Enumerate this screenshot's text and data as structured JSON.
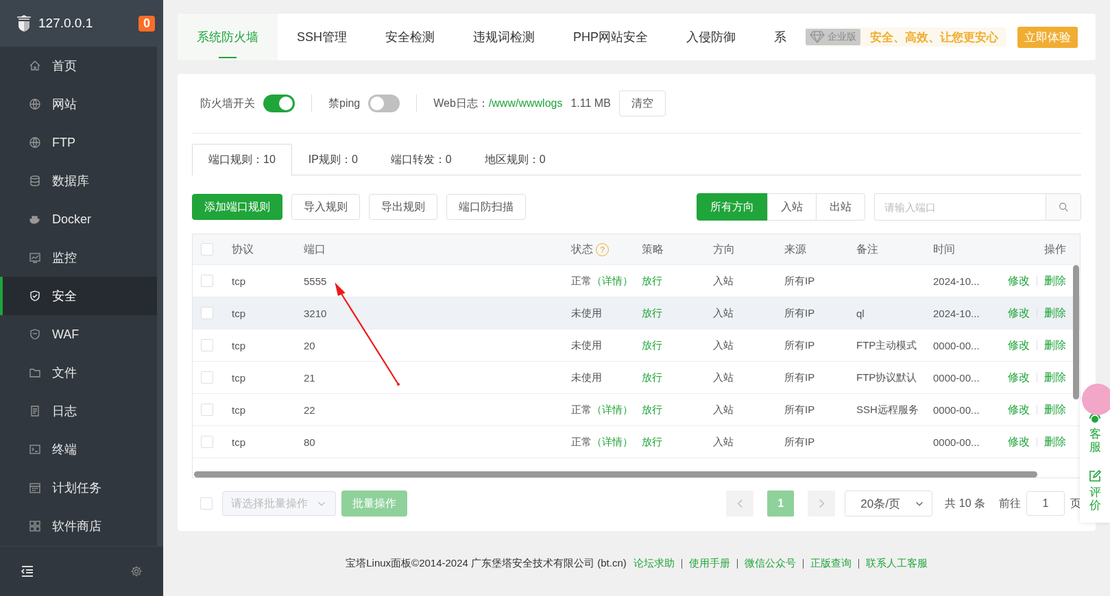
{
  "sidebar": {
    "host": "127.0.0.1",
    "badge": "0",
    "items": [
      {
        "label": "首页",
        "selected": false
      },
      {
        "label": "网站",
        "selected": false
      },
      {
        "label": "FTP",
        "selected": false
      },
      {
        "label": "数据库",
        "selected": false
      },
      {
        "label": "Docker",
        "selected": false
      },
      {
        "label": "监控",
        "selected": false
      },
      {
        "label": "安全",
        "selected": true
      },
      {
        "label": "WAF",
        "selected": false
      },
      {
        "label": "文件",
        "selected": false
      },
      {
        "label": "日志",
        "selected": false
      },
      {
        "label": "终端",
        "selected": false
      },
      {
        "label": "计划任务",
        "selected": false
      },
      {
        "label": "软件商店",
        "selected": false
      }
    ]
  },
  "top_tabs": [
    {
      "label": "系统防火墙",
      "selected": true
    },
    {
      "label": "SSH管理",
      "selected": false
    },
    {
      "label": "安全检测",
      "selected": false
    },
    {
      "label": "违规词检测",
      "selected": false
    },
    {
      "label": "PHP网站安全",
      "selected": false
    },
    {
      "label": "入侵防御",
      "selected": false
    },
    {
      "label": "系",
      "selected": false
    }
  ],
  "promo": {
    "badge": "企业版",
    "slogan": "安全、高效、让您更安心",
    "button": "立即体验"
  },
  "firewall": {
    "switch_label": "防火墙开关",
    "switch_on": true,
    "ping_label": "禁ping",
    "ping_on": false,
    "log_label": "Web日志：",
    "log_path": "/www/wwwlogs",
    "log_size": "1.11 MB",
    "clear_button": "清空"
  },
  "rule_tabs": [
    {
      "label": "端口规则：10",
      "selected": true
    },
    {
      "label": "IP规则：0",
      "selected": false
    },
    {
      "label": "端口转发：0",
      "selected": false
    },
    {
      "label": "地区规则：0",
      "selected": false
    }
  ],
  "actions": [
    {
      "label": "添加端口规则",
      "kind": "primary"
    },
    {
      "label": "导入规则",
      "kind": "default"
    },
    {
      "label": "导出规则",
      "kind": "default"
    },
    {
      "label": "端口防扫描",
      "kind": "default"
    }
  ],
  "direction_filter": [
    {
      "label": "所有方向",
      "selected": true
    },
    {
      "label": "入站",
      "selected": false
    },
    {
      "label": "出站",
      "selected": false
    }
  ],
  "search": {
    "placeholder": "请输入端口"
  },
  "table": {
    "columns": [
      {
        "label": "协议"
      },
      {
        "label": "端口"
      },
      {
        "label": "状态",
        "help": "?"
      },
      {
        "label": "策略"
      },
      {
        "label": "方向"
      },
      {
        "label": "来源"
      },
      {
        "label": "备注"
      },
      {
        "label": "时间"
      },
      {
        "label": "操作"
      }
    ],
    "rows": [
      {
        "protocol": "tcp",
        "port": "5555",
        "status": "正常",
        "detail": "（详情）",
        "policy": "放行",
        "direction": "入站",
        "source": "所有IP",
        "note": "",
        "time": "2024-10...",
        "edit": "修改",
        "delete": "删除",
        "highlighted": false
      },
      {
        "protocol": "tcp",
        "port": "3210",
        "status": "未使用",
        "detail": "",
        "policy": "放行",
        "direction": "入站",
        "source": "所有IP",
        "note": "ql",
        "time": "2024-10...",
        "edit": "修改",
        "delete": "删除",
        "highlighted": true
      },
      {
        "protocol": "tcp",
        "port": "20",
        "status": "未使用",
        "detail": "",
        "policy": "放行",
        "direction": "入站",
        "source": "所有IP",
        "note": "FTP主动模式",
        "time": "0000-00...",
        "edit": "修改",
        "delete": "删除",
        "highlighted": false
      },
      {
        "protocol": "tcp",
        "port": "21",
        "status": "未使用",
        "detail": "",
        "policy": "放行",
        "direction": "入站",
        "source": "所有IP",
        "note": "FTP协议默认",
        "time": "0000-00...",
        "edit": "修改",
        "delete": "删除",
        "highlighted": false
      },
      {
        "protocol": "tcp",
        "port": "22",
        "status": "正常",
        "detail": "（详情）",
        "policy": "放行",
        "direction": "入站",
        "source": "所有IP",
        "note": "SSH远程服务",
        "time": "0000-00...",
        "edit": "修改",
        "delete": "删除",
        "highlighted": false
      },
      {
        "protocol": "tcp",
        "port": "80",
        "status": "正常",
        "detail": "（详情）",
        "policy": "放行",
        "direction": "入站",
        "source": "所有IP",
        "note": "",
        "time": "0000-00...",
        "edit": "修改",
        "delete": "删除",
        "highlighted": false
      }
    ],
    "select_all_checked": false
  },
  "batch": {
    "checked": false,
    "placeholder": "请选择批量操作",
    "button": "批量操作"
  },
  "pagination": {
    "pages": [
      {
        "label": "1",
        "selected": true
      }
    ],
    "page_size": "20条/页",
    "total": "共 10 条",
    "goto_label": "前往",
    "goto_value": "1",
    "page_suffix": "页"
  },
  "footer": {
    "copyright": "宝塔Linux面板©2014-2024 广东堡塔安全技术有限公司 (bt.cn)",
    "links": [
      "论坛求助",
      "使用手册",
      "微信公众号",
      "正版查询",
      "联系人工客服"
    ]
  },
  "float_widget": {
    "service": "客服",
    "review": "评价"
  }
}
